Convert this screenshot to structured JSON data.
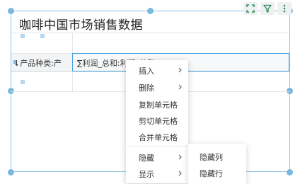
{
  "widget": {
    "title": "咖啡中国市场销售数据"
  },
  "toolbar": {
    "buttons": [
      {
        "icon": "fullscreen-icon"
      },
      {
        "icon": "filter-icon"
      },
      {
        "icon": "more-vertical-icon"
      }
    ]
  },
  "table": {
    "row_dimension": "↓产品种类:产",
    "measure": "∑利润_总和:利润_总和"
  },
  "context_menu": {
    "items": [
      "插入",
      "删除",
      "复制单元格",
      "剪切单元格",
      "合并单元格",
      "隐藏",
      "显示"
    ]
  },
  "submenu": {
    "items": [
      "隐藏列",
      "隐藏行"
    ]
  },
  "colors": {
    "accent": "#4aa1dc",
    "handle": "#7ab8e0",
    "menu_bg": "#ffffff"
  }
}
